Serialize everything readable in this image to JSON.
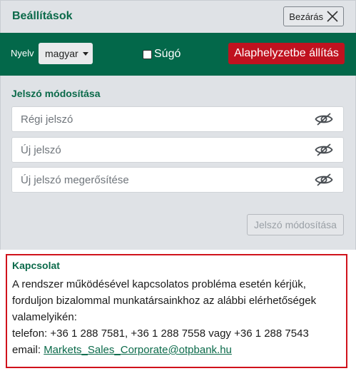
{
  "header": {
    "title": "Beállítások",
    "close_label": "Bezárás"
  },
  "toolbar": {
    "language_label": "Nyelv",
    "language_value": "magyar",
    "help_label": "Súgó",
    "help_checked": false,
    "reset_label": "Alaphelyzetbe állítás"
  },
  "password": {
    "section_title": "Jelszó módosítása",
    "old_placeholder": "Régi jelszó",
    "new_placeholder": "Új jelszó",
    "confirm_placeholder": "Új jelszó megerősítése",
    "submit_label": "Jelszó módosítása"
  },
  "contact": {
    "title": "Kapcsolat",
    "body": "A rendszer működésével kapcsolatos probléma esetén kérjük, forduljon bizalommal munkatársainkhoz az alábbi elérhetőségek valamelyikén:",
    "phone_line": "telefon: +36 1 288 7581, +36 1 288 7558 vagy +36 1 288 7543",
    "email_label": "email:",
    "email": "Markets_Sales_Corporate@otpbank.hu"
  },
  "colors": {
    "brand_green": "#03684a",
    "title_green": "#0b6a4a",
    "reset_red": "#c0121f",
    "highlight_border": "#d0121b",
    "panel_gray": "#dfe2e6"
  },
  "icons": {
    "close": "close-icon",
    "language_dropdown": "chevron-down-icon",
    "password_visibility": "eye-slash-icon"
  }
}
